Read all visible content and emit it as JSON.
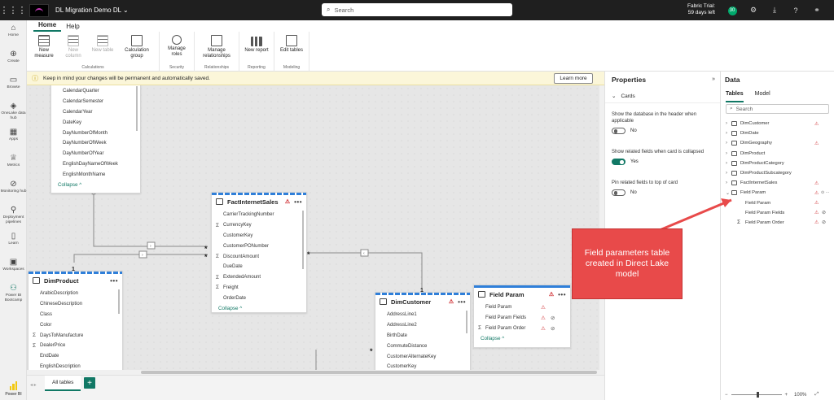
{
  "app": {
    "title": "DL Migration Demo DL",
    "title_chevron": "⌄"
  },
  "search": {
    "placeholder": "Search"
  },
  "trial": {
    "line1": "Fabric Trial:",
    "line2": "59 days left"
  },
  "notification_count": "30",
  "left_rail": [
    {
      "id": "home",
      "label": "Home",
      "icon": "home-icon"
    },
    {
      "id": "create",
      "label": "Create",
      "icon": "plus-circle-icon"
    },
    {
      "id": "browse",
      "label": "Browse",
      "icon": "folder-icon"
    },
    {
      "id": "onelake",
      "label": "OneLake data hub",
      "icon": "onelake-icon"
    },
    {
      "id": "apps",
      "label": "Apps",
      "icon": "apps-icon"
    },
    {
      "id": "metrics",
      "label": "Metrics",
      "icon": "trophy-icon"
    },
    {
      "id": "monitoring",
      "label": "Monitoring hub",
      "icon": "monitor-icon"
    },
    {
      "id": "deployment",
      "label": "Deployment pipelines",
      "icon": "rocket-icon"
    },
    {
      "id": "learn",
      "label": "Learn",
      "icon": "book-icon"
    },
    {
      "id": "workspaces",
      "label": "Workspaces",
      "icon": "workspaces-icon"
    },
    {
      "id": "bootcamp",
      "label": "Power BI Bootcamp",
      "icon": "bootcamp-icon"
    }
  ],
  "rail_bottom_label": "Power BI",
  "ribbon": {
    "tabs": [
      "Home",
      "Help"
    ],
    "groups": [
      {
        "label": "Calculations",
        "buttons": [
          {
            "label": "New measure",
            "disabled": false,
            "icon": "grid"
          },
          {
            "label": "New column",
            "disabled": true,
            "icon": "grid"
          },
          {
            "label": "New table",
            "disabled": true,
            "icon": "grid"
          },
          {
            "label": "Calculation group",
            "disabled": false,
            "icon": "box"
          }
        ]
      },
      {
        "label": "Security",
        "buttons": [
          {
            "label": "Manage roles",
            "disabled": false,
            "icon": "person"
          }
        ]
      },
      {
        "label": "Relationships",
        "buttons": [
          {
            "label": "Manage relationships",
            "disabled": false,
            "icon": "box"
          }
        ]
      },
      {
        "label": "Reporting",
        "buttons": [
          {
            "label": "New report",
            "disabled": false,
            "icon": "bars"
          }
        ]
      },
      {
        "label": "Modeling",
        "buttons": [
          {
            "label": "Edit tables",
            "disabled": false,
            "icon": "box"
          }
        ]
      }
    ]
  },
  "info_bar": {
    "message": "Keep in mind your changes will be permanent and automatically saved.",
    "button": "Learn more"
  },
  "cards": {
    "date": {
      "fields": [
        "CalendarQuarter",
        "CalendarSemester",
        "CalendarYear",
        "DateKey",
        "DayNumberOfMonth",
        "DayNumberOfWeek",
        "DayNumberOfYear",
        "EnglishDayNameOfWeek",
        "EnglishMonthName"
      ],
      "collapse": "Collapse ^"
    },
    "fact": {
      "title": "FactInternetSales",
      "fields": [
        {
          "name": "CarrierTrackingNumber",
          "sigma": false
        },
        {
          "name": "CurrencyKey",
          "sigma": true
        },
        {
          "name": "CustomerKey",
          "sigma": false
        },
        {
          "name": "CustomerPONumber",
          "sigma": false
        },
        {
          "name": "DiscountAmount",
          "sigma": true
        },
        {
          "name": "DueDate",
          "sigma": false
        },
        {
          "name": "ExtendedAmount",
          "sigma": true
        },
        {
          "name": "Freight",
          "sigma": true
        },
        {
          "name": "OrderDate",
          "sigma": false
        }
      ],
      "collapse": "Collapse ^"
    },
    "product": {
      "title": "DimProduct",
      "fields": [
        {
          "name": "ArabicDescription",
          "sigma": false
        },
        {
          "name": "ChineseDescription",
          "sigma": false
        },
        {
          "name": "Class",
          "sigma": false
        },
        {
          "name": "Color",
          "sigma": false
        },
        {
          "name": "DaysToManufacture",
          "sigma": true
        },
        {
          "name": "DealerPrice",
          "sigma": true
        },
        {
          "name": "EndDate",
          "sigma": false
        },
        {
          "name": "EnglishDescription",
          "sigma": false
        }
      ]
    },
    "customer": {
      "title": "DimCustomer",
      "fields": [
        {
          "name": "AddressLine1",
          "sigma": false
        },
        {
          "name": "AddressLine2",
          "sigma": false
        },
        {
          "name": "BirthDate",
          "sigma": false
        },
        {
          "name": "CommuteDistance",
          "sigma": false
        },
        {
          "name": "CustomerAlternateKey",
          "sigma": false
        },
        {
          "name": "CustomerKey",
          "sigma": false
        }
      ]
    },
    "field_param": {
      "title": "Field Param",
      "fields": [
        {
          "name": "Field Param",
          "sigma": false,
          "eye": false
        },
        {
          "name": "Field Param Fields",
          "sigma": false,
          "eye": true
        },
        {
          "name": "Field Param Order",
          "sigma": true,
          "eye": true
        }
      ],
      "collapse": "Collapse ^"
    }
  },
  "relationship_labels": {
    "one": "1",
    "many": "*"
  },
  "properties": {
    "title": "Properties",
    "section": "Cards",
    "options": [
      {
        "label": "Show the database in the header when applicable",
        "state": "No",
        "on": false
      },
      {
        "label": "Show related fields when card is collapsed",
        "state": "Yes",
        "on": true
      },
      {
        "label": "Pin related fields to top of card",
        "state": "No",
        "on": false
      }
    ]
  },
  "data_pane": {
    "title": "Data",
    "tabs": [
      "Tables",
      "Model"
    ],
    "search_placeholder": "Search",
    "tables": [
      {
        "name": "DimCustomer",
        "warn": true
      },
      {
        "name": "DimDate",
        "warn": false
      },
      {
        "name": "DimGeography",
        "warn": true
      },
      {
        "name": "DimProduct",
        "warn": false
      },
      {
        "name": "DimProductCategory",
        "warn": false
      },
      {
        "name": "DimProductSubcategory",
        "warn": false
      },
      {
        "name": "FactInternetSales",
        "warn": true
      },
      {
        "name": "Field Param",
        "warn": true,
        "expanded": true
      }
    ],
    "field_param_children": [
      {
        "name": "Field Param",
        "sigma": false
      },
      {
        "name": "Field Param Fields",
        "sigma": false
      },
      {
        "name": "Field Param Order",
        "sigma": true
      }
    ]
  },
  "bottom": {
    "tab": "All tables",
    "add": "+"
  },
  "status": {
    "zoom": "100%",
    "minus": "−",
    "plus": "+"
  },
  "callout": {
    "text": "Field parameters table created in Direct Lake model"
  },
  "colors": {
    "accent": "#117865",
    "warning": "#d13438",
    "callout": "#e84a4a",
    "stripe": "#2f7fd9"
  }
}
